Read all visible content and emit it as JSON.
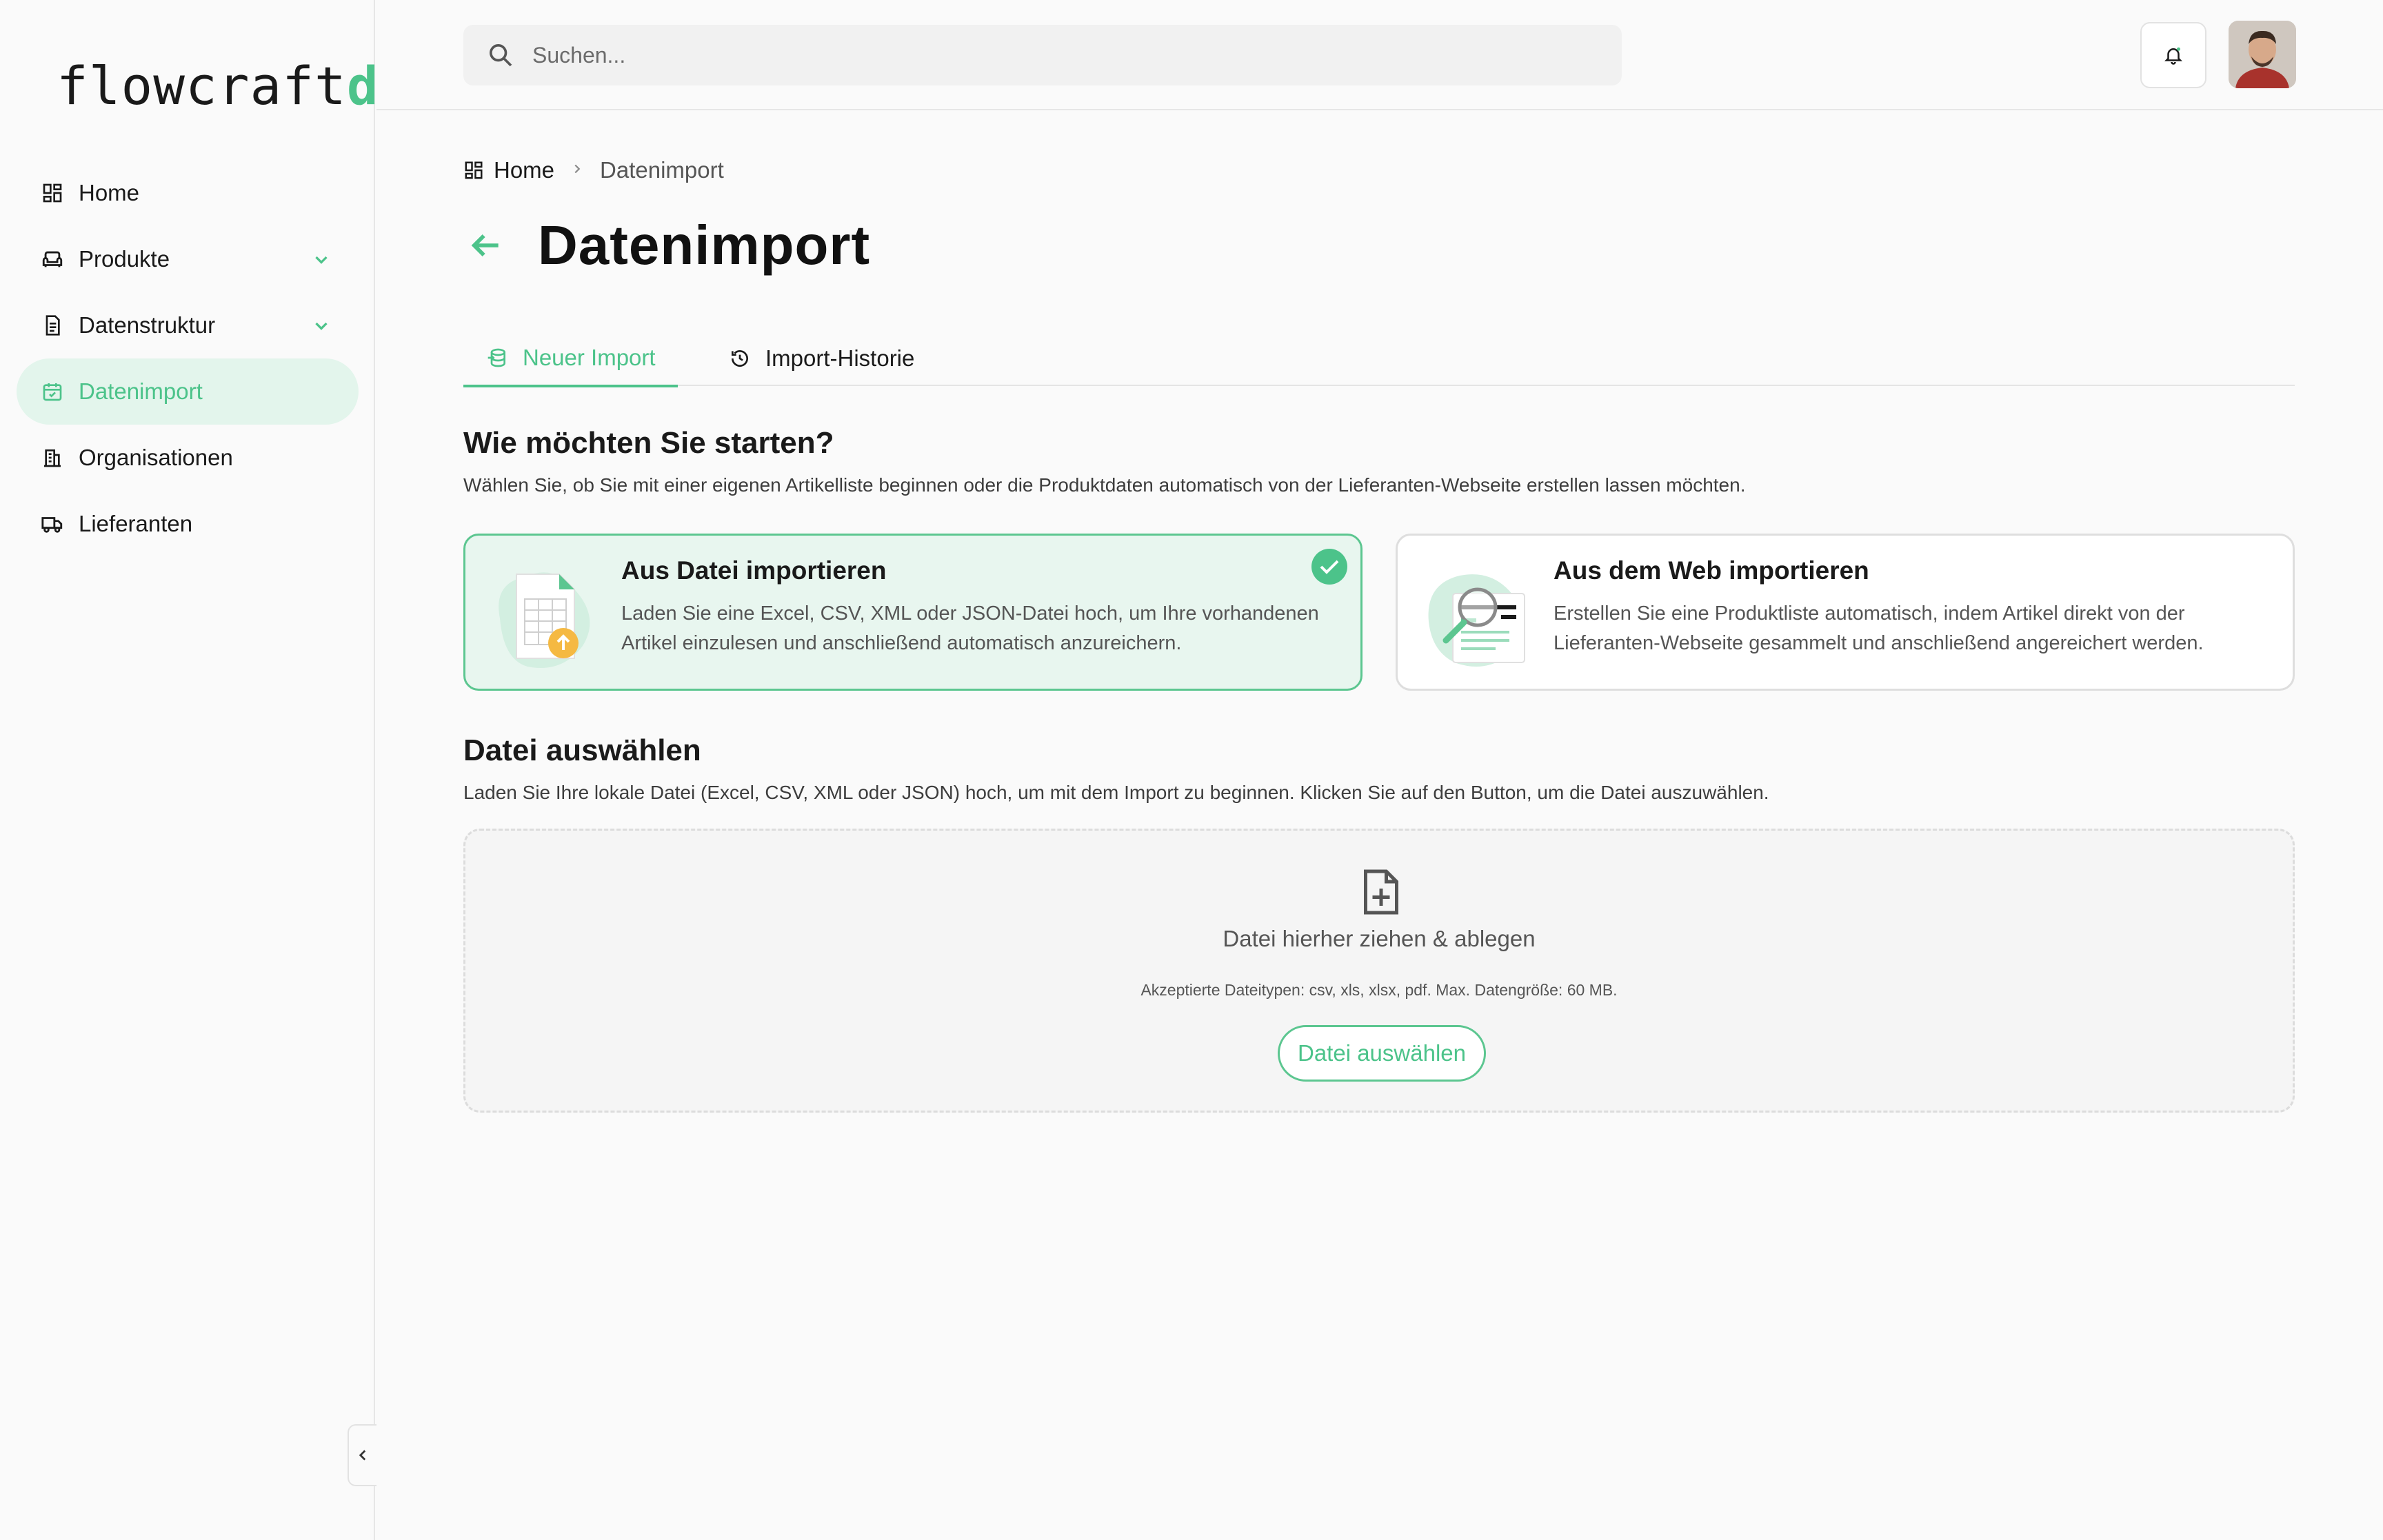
{
  "brand": {
    "logo_text": "flowcraft",
    "logo_accent": "db",
    "accent_color": "#4cc38a"
  },
  "sidebar": {
    "items": [
      {
        "label": "Home",
        "icon": "dashboard-icon"
      },
      {
        "label": "Produkte",
        "icon": "sofa-icon",
        "expandable": true
      },
      {
        "label": "Datenstruktur",
        "icon": "document-icon",
        "expandable": true
      },
      {
        "label": "Datenimport",
        "icon": "calendar-import-icon",
        "active": true
      },
      {
        "label": "Organisationen",
        "icon": "building-icon"
      },
      {
        "label": "Lieferanten",
        "icon": "truck-icon"
      }
    ],
    "collapse_icon": "chevron-left-icon"
  },
  "header": {
    "search_placeholder": "Suchen...",
    "notification_icon": "bell-icon",
    "avatar": "user-avatar"
  },
  "breadcrumb": {
    "home": "Home",
    "current": "Datenimport"
  },
  "page": {
    "title": "Datenimport"
  },
  "tabs": [
    {
      "label": "Neuer Import",
      "icon": "database-import-icon",
      "active": true
    },
    {
      "label": "Import-Historie",
      "icon": "history-icon",
      "active": false
    }
  ],
  "start_section": {
    "title": "Wie möchten Sie starten?",
    "subtitle": "Wählen Sie, ob Sie mit einer eigenen Artikelliste beginnen oder die Produktdaten automatisch von der Lieferanten-Webseite erstellen lassen möchten."
  },
  "options": [
    {
      "title": "Aus Datei importieren",
      "description": "Laden Sie eine Excel, CSV, XML oder JSON-Datei hoch, um Ihre vorhandenen Artikel einzulesen und anschließend automatisch anzureichern.",
      "selected": true
    },
    {
      "title": "Aus dem Web importieren",
      "description": "Erstellen Sie eine Produktliste automatisch, indem Artikel direkt von der Lieferanten-Webseite gesammelt und anschließend angereichert werden.",
      "selected": false
    }
  ],
  "file_section": {
    "title": "Datei auswählen",
    "subtitle": "Laden Sie Ihre lokale Datei (Excel, CSV, XML oder JSON) hoch, um mit dem Import zu beginnen. Klicken Sie auf den Button, um die Datei auszuwählen.",
    "drop_text": "Datei hierher ziehen & ablegen",
    "accepted_types": "Akzeptierte Dateitypen: csv, xls, xlsx, pdf. Max. Datengröße: 60 MB.",
    "button_label": "Datei auswählen"
  }
}
